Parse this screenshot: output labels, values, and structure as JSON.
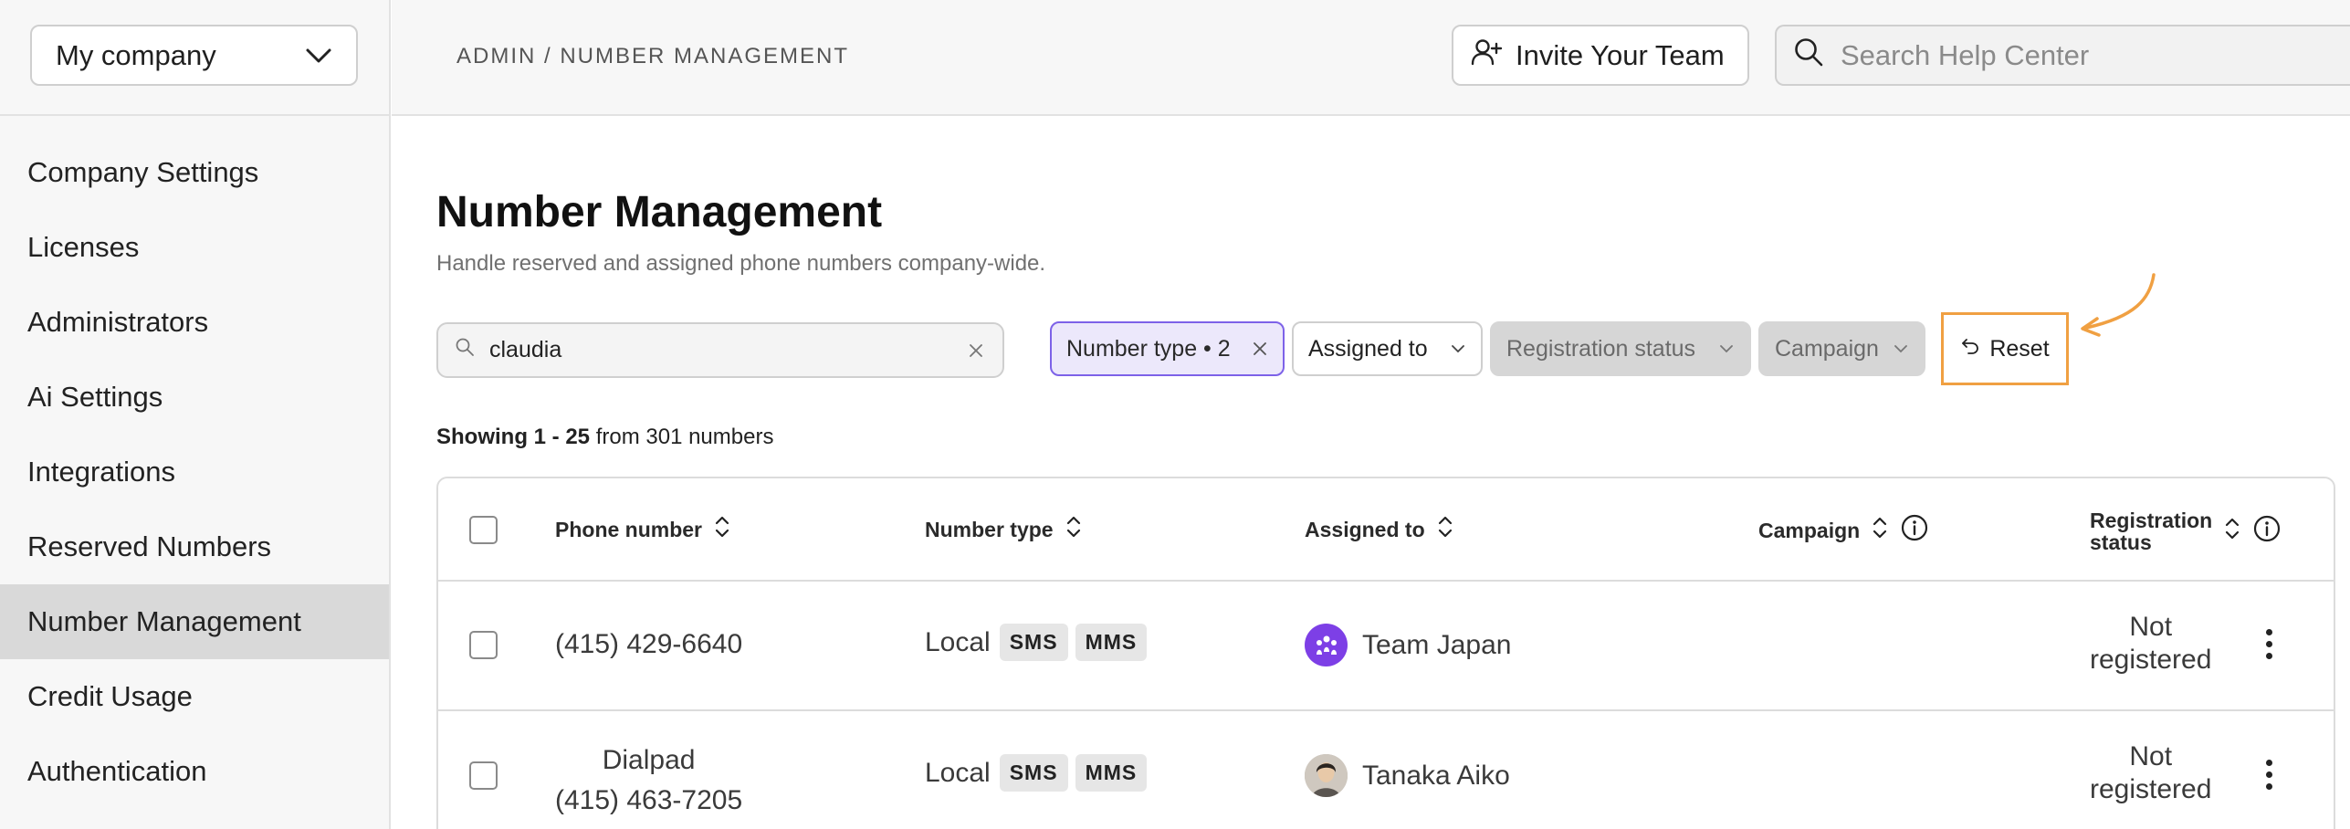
{
  "company_selector": {
    "value": "My company",
    "icon": "chevron-down-icon"
  },
  "sidebar": {
    "items": [
      {
        "label": "Company Settings",
        "active": false
      },
      {
        "label": "Licenses",
        "active": false
      },
      {
        "label": "Administrators",
        "active": false
      },
      {
        "label": "Ai Settings",
        "active": false
      },
      {
        "label": "Integrations",
        "active": false
      },
      {
        "label": "Reserved Numbers",
        "active": false
      },
      {
        "label": "Number Management",
        "active": true
      },
      {
        "label": "Credit Usage",
        "active": false
      },
      {
        "label": "Authentication",
        "active": false
      }
    ]
  },
  "header": {
    "breadcrumb": "ADMIN / NUMBER MANAGEMENT",
    "invite_label": "Invite Your Team",
    "help_search_placeholder": "Search Help Center"
  },
  "main": {
    "title": "Number Management",
    "subtitle": "Handle reserved and assigned phone numbers company-wide.",
    "search_value": "claudia",
    "filters": {
      "number_type": "Number type • 2",
      "assigned_to": "Assigned to",
      "registration_status": "Registration status",
      "campaign": "Campaign",
      "reset": "Reset"
    },
    "showing": {
      "range": "Showing 1 - 25",
      "rest": "from 301 numbers"
    }
  },
  "table": {
    "columns": {
      "phone_number": "Phone number",
      "number_type": "Number type",
      "assigned_to": "Assigned to",
      "campaign": "Campaign",
      "registration_status_line1": "Registration",
      "registration_status_line2": "status"
    },
    "rows": [
      {
        "phone_name": "",
        "phone": "(415) 429-6640",
        "type": "Local",
        "tags": [
          "SMS",
          "MMS"
        ],
        "assignee": "Team Japan",
        "avatar": "team-avatar",
        "campaign": "",
        "status_line1": "Not",
        "status_line2": "registered"
      },
      {
        "phone_name": "Dialpad",
        "phone": "(415) 463-7205",
        "type": "Local",
        "tags": [
          "SMS",
          "MMS"
        ],
        "assignee": "Tanaka Aiko",
        "avatar": "person-avatar",
        "campaign": "",
        "status_line1": "Not",
        "status_line2": "registered"
      }
    ]
  },
  "colors": {
    "accent_purple": "#7d62e8",
    "reset_highlight": "#f0a042",
    "active_nav": "#d9d9d9"
  }
}
